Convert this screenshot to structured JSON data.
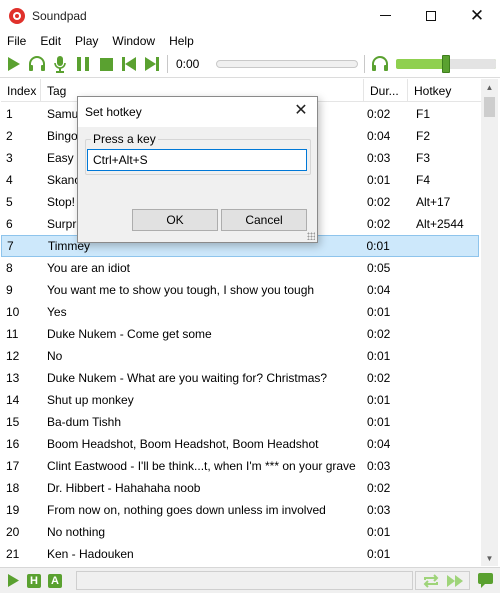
{
  "app": {
    "title": "Soundpad"
  },
  "menu": [
    "File",
    "Edit",
    "Play",
    "Window",
    "Help"
  ],
  "player": {
    "time": "0:00",
    "volume_fraction": 0.5
  },
  "table": {
    "columns": {
      "index": "Index",
      "tag": "Tag",
      "duration": "Dur...",
      "hotkey": "Hotkey"
    },
    "rows": [
      {
        "index": "1",
        "tag": "Samu",
        "duration": "0:02",
        "hotkey": "F1"
      },
      {
        "index": "2",
        "tag": "Bingo",
        "duration": "0:04",
        "hotkey": "F2"
      },
      {
        "index": "3",
        "tag": "Easy p",
        "duration": "0:03",
        "hotkey": "F3"
      },
      {
        "index": "4",
        "tag": "Skano",
        "duration": "0:01",
        "hotkey": "F4"
      },
      {
        "index": "5",
        "tag": "Stop!",
        "duration": "0:02",
        "hotkey": "Alt+17"
      },
      {
        "index": "6",
        "tag": "Surpr",
        "duration": "0:02",
        "hotkey": "Alt+2544"
      },
      {
        "index": "7",
        "tag": "Timmey",
        "duration": "0:01",
        "hotkey": ""
      },
      {
        "index": "8",
        "tag": "You are an idiot",
        "duration": "0:05",
        "hotkey": ""
      },
      {
        "index": "9",
        "tag": "You want me to show you tough, I show you tough",
        "duration": "0:04",
        "hotkey": ""
      },
      {
        "index": "10",
        "tag": "Yes",
        "duration": "0:01",
        "hotkey": ""
      },
      {
        "index": "11",
        "tag": "Duke Nukem - Come get some",
        "duration": "0:02",
        "hotkey": ""
      },
      {
        "index": "12",
        "tag": "No",
        "duration": "0:01",
        "hotkey": ""
      },
      {
        "index": "13",
        "tag": "Duke Nukem - What are you waiting for? Christmas?",
        "duration": "0:02",
        "hotkey": ""
      },
      {
        "index": "14",
        "tag": "Shut up monkey",
        "duration": "0:01",
        "hotkey": ""
      },
      {
        "index": "15",
        "tag": "Ba-dum Tishh",
        "duration": "0:01",
        "hotkey": ""
      },
      {
        "index": "16",
        "tag": "Boom Headshot, Boom Headshot, Boom Headshot",
        "duration": "0:04",
        "hotkey": ""
      },
      {
        "index": "17",
        "tag": "Clint Eastwood - I'll be think...t, when I'm *** on your grave",
        "duration": "0:03",
        "hotkey": ""
      },
      {
        "index": "18",
        "tag": "Dr. Hibbert - Hahahaha noob",
        "duration": "0:02",
        "hotkey": ""
      },
      {
        "index": "19",
        "tag": "From now on, nothing goes down unless im involved",
        "duration": "0:03",
        "hotkey": ""
      },
      {
        "index": "20",
        "tag": "No nothing",
        "duration": "0:01",
        "hotkey": ""
      },
      {
        "index": "21",
        "tag": "Ken - Hadouken",
        "duration": "0:01",
        "hotkey": ""
      }
    ],
    "selected_index": "7"
  },
  "statusbar": {
    "h_label": "H",
    "a_label": "A"
  },
  "dialog": {
    "title": "Set hotkey",
    "group_label": "Press a key",
    "key_value": "Ctrl+Alt+S",
    "ok_label": "OK",
    "cancel_label": "Cancel"
  },
  "colors": {
    "accent_green": "#5aa130",
    "selection": "#cde8fb",
    "brand_red": "#e0312b"
  }
}
